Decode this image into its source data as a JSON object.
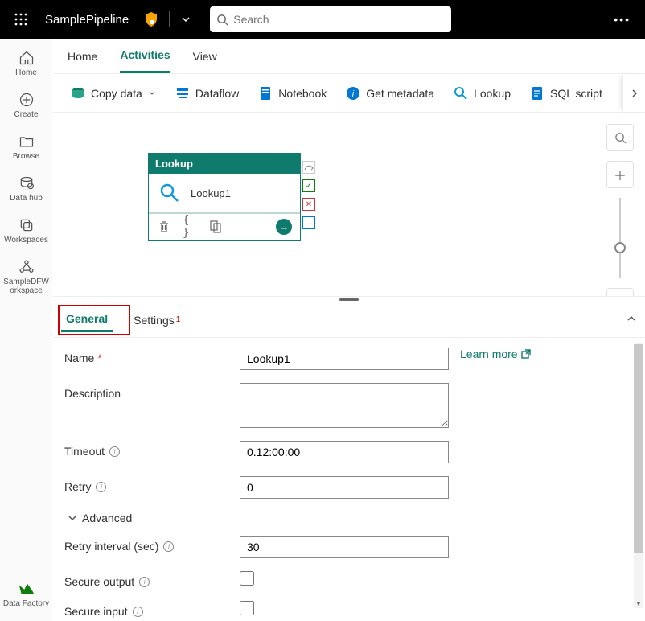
{
  "header": {
    "appName": "SamplePipeline",
    "searchPlaceholder": "Search"
  },
  "leftnav": [
    {
      "label": "Home",
      "icon": "home"
    },
    {
      "label": "Create",
      "icon": "plus-circle"
    },
    {
      "label": "Browse",
      "icon": "folder"
    },
    {
      "label": "Data hub",
      "icon": "db-stack"
    },
    {
      "label": "Workspaces",
      "icon": "workspaces"
    },
    {
      "label": "SampleDFW\norkspace",
      "icon": "graph"
    },
    {
      "label": "Data Factory",
      "icon": "df"
    }
  ],
  "ribbonTabs": [
    "Home",
    "Activities",
    "View"
  ],
  "activeRibbon": "Activities",
  "toolbar": [
    {
      "label": "Copy data",
      "icon": "copydata",
      "chevron": true
    },
    {
      "label": "Dataflow",
      "icon": "dataflow"
    },
    {
      "label": "Notebook",
      "icon": "notebook"
    },
    {
      "label": "Get metadata",
      "icon": "info"
    },
    {
      "label": "Lookup",
      "icon": "lookup"
    },
    {
      "label": "SQL script",
      "icon": "sql"
    }
  ],
  "activity": {
    "type": "Lookup",
    "name": "Lookup1"
  },
  "propTabs": [
    "General",
    "Settings"
  ],
  "activePropTab": "General",
  "settingsBadge": "1",
  "form": {
    "nameLabel": "Name",
    "name": "Lookup1",
    "descLabel": "Description",
    "description": "",
    "timeoutLabel": "Timeout",
    "timeout": "0.12:00:00",
    "retryLabel": "Retry",
    "retry": "0",
    "advancedLabel": "Advanced",
    "retryIntervalLabel": "Retry interval (sec)",
    "retryInterval": "30",
    "secureOutputLabel": "Secure output",
    "secureOutput": false,
    "secureInputLabel": "Secure input",
    "secureInput": false,
    "learnMore": "Learn more"
  }
}
